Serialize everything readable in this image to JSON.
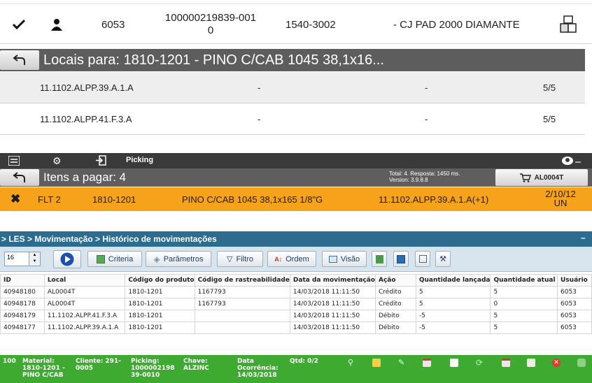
{
  "top_row": {
    "qty": "6053",
    "code_line1": "100000219839-001",
    "code_line2": "0",
    "product_code": "1540-3002",
    "description": "- CJ PAD 2000 DIAMANTE"
  },
  "locais": {
    "title": "Locais para: 1810-1201 - PINO C/CAB 1045 38,1x16...",
    "rows": [
      {
        "location": "11.1102.ALPP.39.A.1.A",
        "col2": "-",
        "col3": "-",
        "qty": "5/5"
      },
      {
        "location": "11.1102.ALPP.41.F.3.A",
        "col2": "-",
        "col3": "-",
        "qty": "5/5"
      }
    ]
  },
  "picking": {
    "toolbar_label": "Picking",
    "header_title": "Itens a pagar: 4",
    "info_line1": "Total: 4. Resposta: 1450 ms.",
    "info_line2": "Version: 3.9.8.8",
    "cart_label": "AL0004T",
    "row": {
      "flt": "FLT 2",
      "product": "1810-1201",
      "description": "PINO C/CAB 1045 38,1x165 1/8\"G",
      "location": "11.1102.ALPP.39.A.1.A(+1)",
      "qty_line1": "2/10/12",
      "qty_line2": "UN"
    }
  },
  "les": {
    "breadcrumb": "> LES > Movimentação > Histórico de movimentações",
    "page_size": "16",
    "buttons": {
      "criteria": "Criteria",
      "parametros": "Parâmetros",
      "filtro": "Filtro",
      "ordem": "Ordem",
      "visao": "Visão"
    },
    "columns": [
      "ID",
      "Local",
      "Código do produto",
      "Código de rastreabilidade",
      "Data da movimentação",
      "Ação",
      "Quantidade lançada",
      "Quantidade atual",
      "Usuário"
    ],
    "rows": [
      [
        "40948180",
        "AL0004T",
        "1810-1201",
        "1167793",
        "14/03/2018 11:11:50",
        "Crédito",
        "5",
        "5",
        "6053"
      ],
      [
        "40948178",
        "AL0004T",
        "1810-1201",
        "1167793",
        "14/03/2018 11:11:50",
        "Crédito",
        "5",
        "0",
        "6053"
      ],
      [
        "40948179",
        "11.1102.ALPP.41.F.3.A",
        "1810-1201",
        "",
        "14/03/2018 11:11:50",
        "Débito",
        "-5",
        "5",
        "6053"
      ],
      [
        "40948177",
        "11.1102.ALPP.39.A.1.A",
        "1810-1201",
        "",
        "14/03/2018 11:11:50",
        "Débito",
        "-5",
        "5",
        "6053"
      ]
    ]
  },
  "green_bar": {
    "number": "100",
    "material": "Material:\n1810-1201 -\nPINO C/CAB",
    "cliente": "Cliente: 291-\n0005",
    "picking": "Picking:\n1000002198\n39-0010",
    "chave": "Chave:\nALZINC",
    "data": "Data\nOcorrência:\n14/03/2018",
    "qtd": "Qtd: 0/2"
  },
  "colors": {
    "orange_row": "#f7a21b",
    "green_bar": "#3faa31",
    "les_header": "#2c6c8e",
    "dark_header": "#5e5e5e"
  }
}
